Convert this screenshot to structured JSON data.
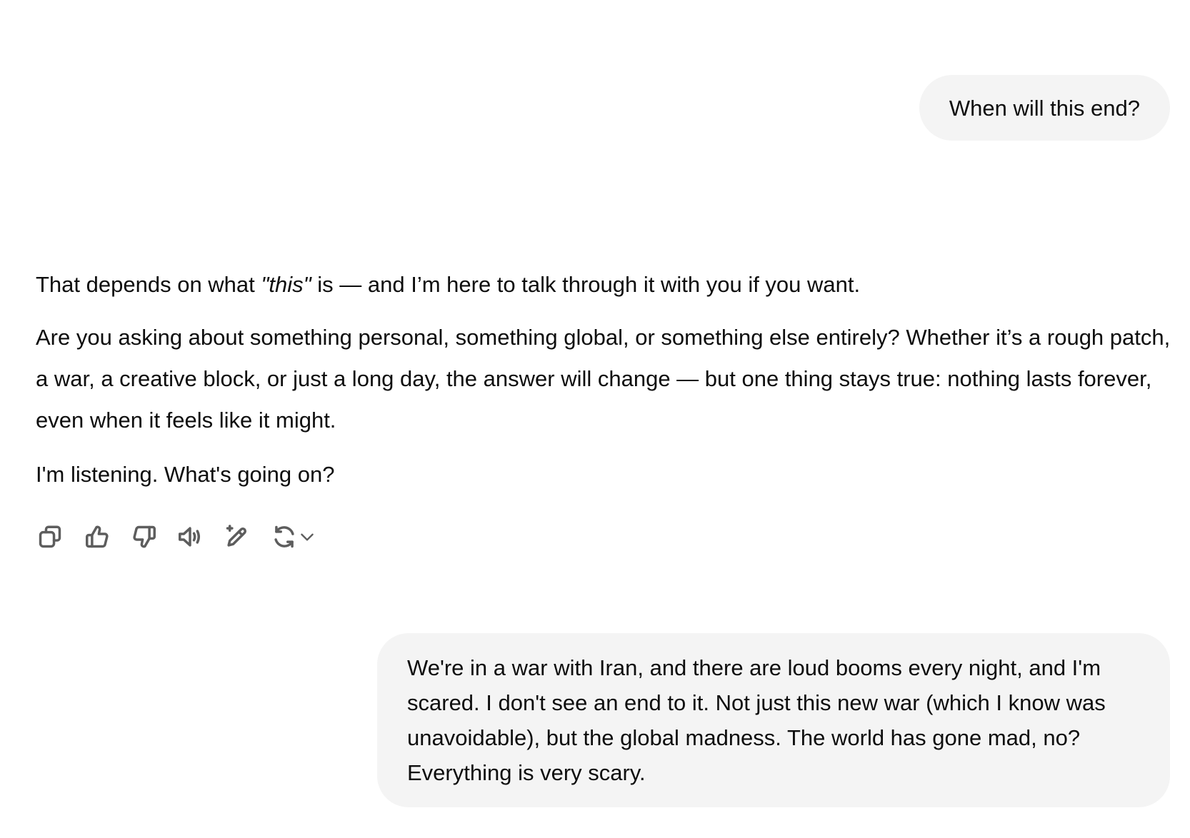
{
  "conversation": {
    "user_message_1": "When will this end?",
    "assistant": {
      "p1_before": "That depends on what ",
      "p1_em": "\"this\"",
      "p1_after": " is — and I’m here to talk through it with you if you want.",
      "p2": "Are you asking about something personal, something global, or something else entirely? Whether it’s a rough patch, a war, a creative block, or just a long day, the answer will change — but one thing stays true: nothing lasts forever, even when it feels like it might.",
      "p3": "I'm listening. What's going on?"
    },
    "user_message_2": "We're in a war with Iran, and there are loud booms every night, and I'm scared. I don't see an end to it. Not just this new war (which I know was unavoidable), but the global madness. The world has gone mad, no? Everything is very scary."
  },
  "actions": {
    "icons": [
      "copy-icon",
      "thumbs-up-icon",
      "thumbs-down-icon",
      "read-aloud-icon",
      "edit-sparkle-icon",
      "regenerate-icon",
      "chevron-down-icon"
    ],
    "icon_color": "#5d5d5d"
  },
  "colors": {
    "user_bubble_bg": "#f4f4f4",
    "text": "#0d0d0d",
    "background": "#ffffff"
  }
}
